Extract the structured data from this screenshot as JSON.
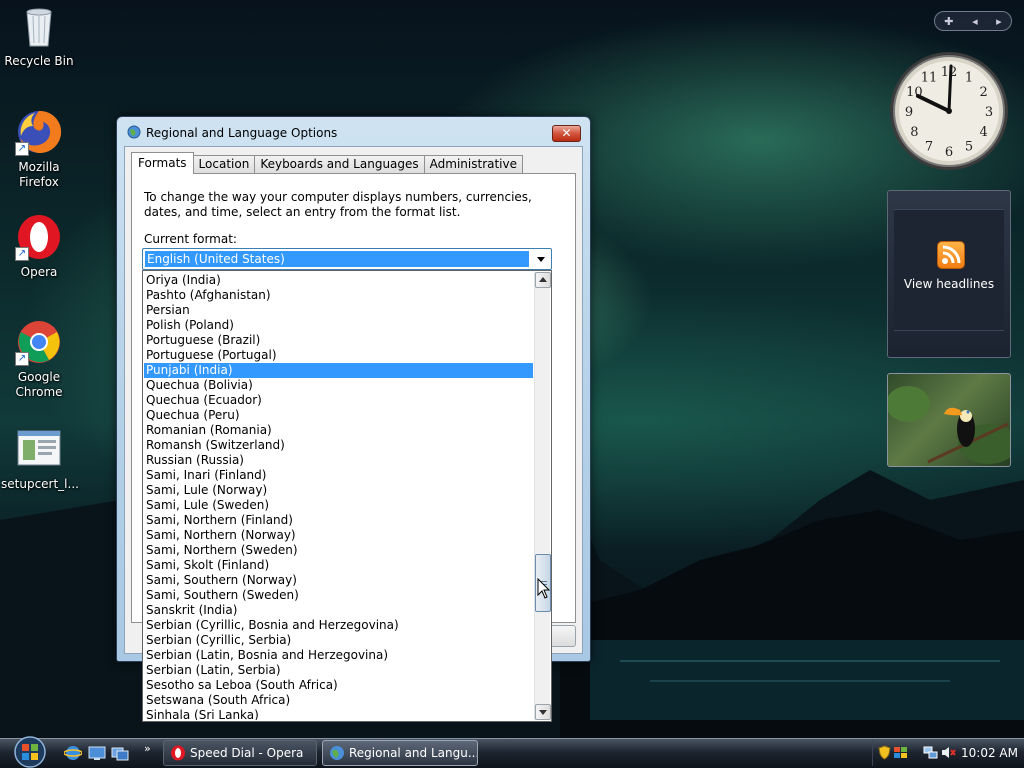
{
  "desktop": {
    "icons": [
      {
        "label": "Recycle Bin"
      },
      {
        "label": "Mozilla Firefox"
      },
      {
        "label": "Opera"
      },
      {
        "label": "Google Chrome"
      },
      {
        "label": "setupcert_l..."
      }
    ]
  },
  "gadgets": {
    "feed_label": "View headlines",
    "clock_numbers": [
      "12",
      "1",
      "2",
      "3",
      "4",
      "5",
      "6",
      "7",
      "8",
      "9",
      "10",
      "11"
    ]
  },
  "dialog": {
    "title": "Regional and Language Options",
    "close_symbol": "✕",
    "tabs": [
      "Formats",
      "Location",
      "Keyboards and Languages",
      "Administrative"
    ],
    "active_tab": "Formats",
    "intro": "To change the way your computer displays numbers, currencies, dates, and time, select an entry from the format list.",
    "current_format_label": "Current format:",
    "current_format_value": "English (United States)",
    "list_items": [
      "Oriya (India)",
      "Pashto (Afghanistan)",
      "Persian",
      "Polish (Poland)",
      "Portuguese (Brazil)",
      "Portuguese (Portugal)",
      "Punjabi (India)",
      "Quechua (Bolivia)",
      "Quechua (Ecuador)",
      "Quechua (Peru)",
      "Romanian (Romania)",
      "Romansh (Switzerland)",
      "Russian (Russia)",
      "Sami, Inari (Finland)",
      "Sami, Lule (Norway)",
      "Sami, Lule (Sweden)",
      "Sami, Northern (Finland)",
      "Sami, Northern (Norway)",
      "Sami, Northern (Sweden)",
      "Sami, Skolt (Finland)",
      "Sami, Southern (Norway)",
      "Sami, Southern (Sweden)",
      "Sanskrit (India)",
      "Serbian (Cyrillic, Bosnia and Herzegovina)",
      "Serbian (Cyrillic, Serbia)",
      "Serbian (Latin, Bosnia and Herzegovina)",
      "Serbian (Latin, Serbia)",
      "Sesotho sa Leboa (South Africa)",
      "Setswana (South Africa)",
      "Sinhala (Sri Lanka)"
    ],
    "selected_item": "Punjabi (India)"
  },
  "taskbar": {
    "quick_launch_more": "»",
    "buttons": [
      {
        "label": "Speed Dial - Opera"
      },
      {
        "label": "Regional and Langu..."
      }
    ],
    "active_button": "Regional and Langu...",
    "time": "10:02 AM"
  },
  "colors": {
    "selection": "#3399ff",
    "dialog_frame": "#b9d4ea",
    "taskbar": "#1d2530"
  }
}
